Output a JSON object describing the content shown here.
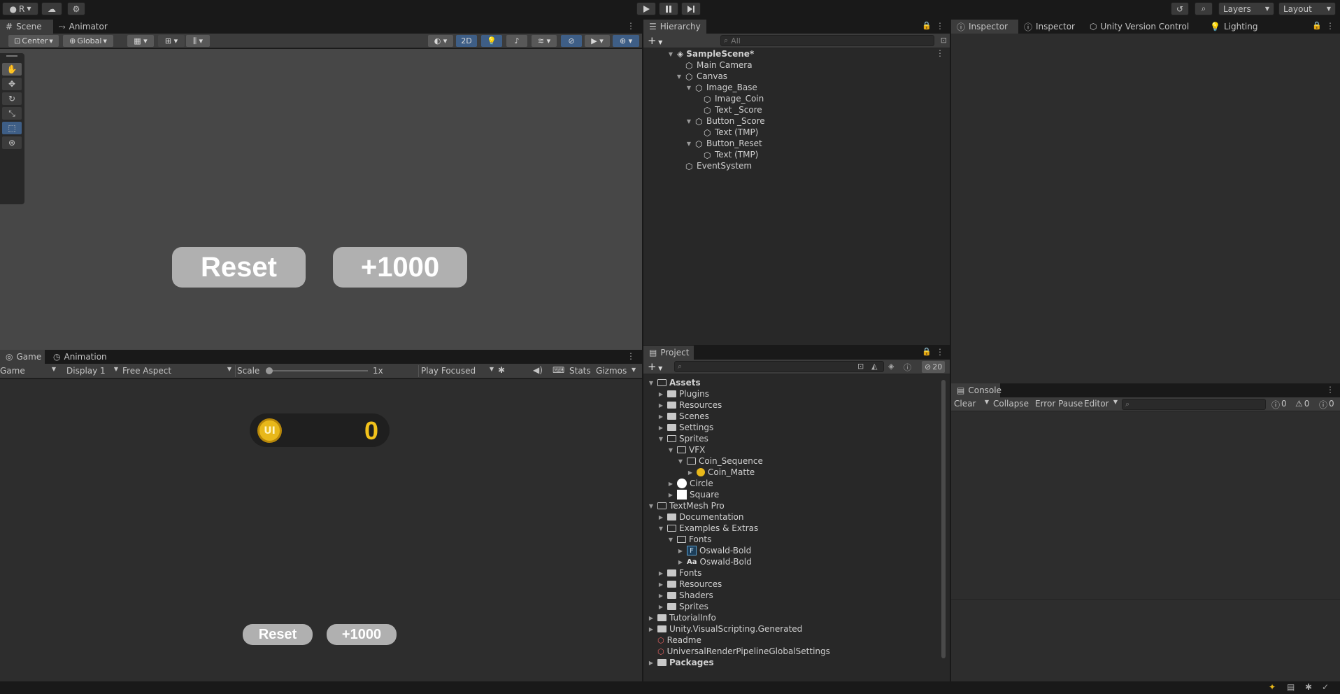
{
  "topbar": {
    "account_label": "R",
    "layers_label": "Layers",
    "layout_label": "Layout"
  },
  "scene_panel": {
    "tabs": [
      "Scene",
      "Animator"
    ],
    "pivot_label": "Center",
    "space_label": "Global",
    "mode_2d": "2D",
    "scene_buttons": [
      "Reset",
      "+1000"
    ]
  },
  "game_panel": {
    "tabs": [
      "Game",
      "Animation"
    ],
    "view_select": "Game",
    "display_select": "Display 1",
    "aspect_select": "Free Aspect",
    "scale_label": "Scale",
    "scale_value": "1x",
    "scale_level": 0.0,
    "play_mode": "Play Focused",
    "stats_label": "Stats",
    "gizmos_label": "Gizmos",
    "score_value": "0",
    "coin_label": "UI",
    "game_buttons": [
      "Reset",
      "+1000"
    ]
  },
  "hierarchy": {
    "tab": "Hierarchy",
    "search_placeholder": "All",
    "scene_name": "SampleScene*",
    "items": [
      "Main Camera",
      "Canvas",
      "Image_Base",
      "Image_Coin",
      "Text _Score",
      "Button _Score",
      "Text (TMP)",
      "Button_Reset",
      "Text (TMP)",
      "EventSystem"
    ]
  },
  "project": {
    "tab": "Project",
    "hidden_count": "20",
    "assets_label": "Assets",
    "items": [
      "Plugins",
      "Resources",
      "Scenes",
      "Settings",
      "Sprites",
      "VFX",
      "Coin_Sequence",
      "Coin_Matte",
      "Circle",
      "Square",
      "TextMesh Pro",
      "Documentation",
      "Examples & Extras",
      "Fonts",
      "Oswald-Bold",
      "Oswald-Bold",
      "Fonts",
      "Resources",
      "Shaders",
      "Sprites",
      "TutorialInfo",
      "Unity.VisualScripting.Generated",
      "Readme",
      "UniversalRenderPipelineGlobalSettings"
    ],
    "font_asset_glyph": "F",
    "font_file_glyph": "Aa",
    "packages_label": "Packages"
  },
  "inspector_tabs": [
    "Inspector",
    "Inspector",
    "Unity Version Control",
    "Lighting"
  ],
  "console": {
    "tab": "Console",
    "clear_label": "Clear",
    "collapse_label": "Collapse",
    "error_pause_label": "Error Pause",
    "editor_label": "Editor",
    "info_count": "0",
    "warn_count": "0",
    "error_count": "0"
  },
  "colors": {
    "accent_blue": "#3e5e86",
    "coin_gold": "#e8b81a",
    "score_gold": "#f2c21b"
  }
}
